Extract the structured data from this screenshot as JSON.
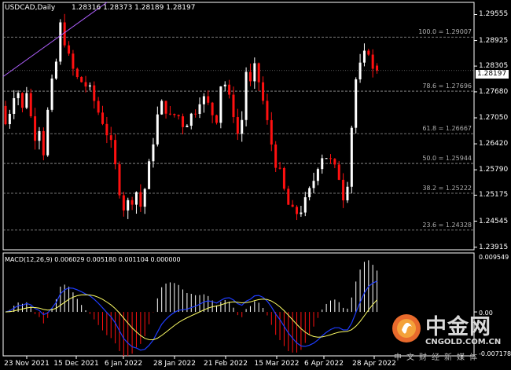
{
  "header": {
    "symbol_tf": "USDCAD,Daily",
    "ohlc": "1.28316 1.28373 1.28189 1.28197"
  },
  "price_axis": {
    "ticks": [
      "1.29555",
      "1.28925",
      "1.28305",
      "1.27680",
      "1.27050",
      "1.26420",
      "1.25790",
      "1.25175",
      "1.24545",
      "1.23915"
    ],
    "current": "1.28197"
  },
  "fib_levels": [
    {
      "label": "100.0 = 1.29007",
      "price": 1.29007
    },
    {
      "label": "78.6 = 1.27696",
      "price": 1.27696
    },
    {
      "label": "61.8 = 1.26667",
      "price": 1.26667
    },
    {
      "label": "50.0 = 1.25944",
      "price": 1.25944
    },
    {
      "label": "38.2 = 1.25222",
      "price": 1.25222
    },
    {
      "label": "23.6 = 1.24328",
      "price": 1.24328
    }
  ],
  "macd": {
    "label": "MACD(12,26,9) 0.006029 0.005180 0.001104 0.000000",
    "ticks": [
      "0.009549",
      "0.00",
      "-0.007178"
    ]
  },
  "time_axis": {
    "labels": [
      "23 Nov 2021",
      "15 Dec 2021",
      "6 Jan 2022",
      "28 Jan 2022",
      "21 Feb 2022",
      "15 Mar 2022",
      "6 Apr 2022",
      "28 Apr 2022"
    ]
  },
  "colors": {
    "bull": "#ffffff",
    "bear": "#ff1010",
    "macd_line": "#1e3cff",
    "signal_line": "#ffff66",
    "grid": "#9a9a9a",
    "trendline": "#b060ff"
  },
  "watermark": {
    "brand": "中金网",
    "url": "CNGOLD.COM.CN",
    "tagline": "中文财经新媒体",
    "icon": "cngold-logo-icon"
  },
  "chart_data": {
    "type": "candlestick",
    "symbol": "USDCAD",
    "timeframe": "Daily",
    "ylim": [
      1.2385,
      1.2985
    ],
    "last_close": 1.28197,
    "ohlc_last": {
      "open": 1.28316,
      "high": 1.28373,
      "low": 1.28189,
      "close": 1.28197
    },
    "fib_retracement": [
      1.29007,
      1.27696,
      1.26667,
      1.25944,
      1.25222,
      1.24328
    ],
    "macd_params": [
      12,
      26,
      9
    ],
    "macd_values": {
      "macd": 0.006029,
      "signal": 0.00518,
      "osma": 0.001104
    },
    "macd_ylim": [
      -0.007178,
      0.009549
    ]
  }
}
